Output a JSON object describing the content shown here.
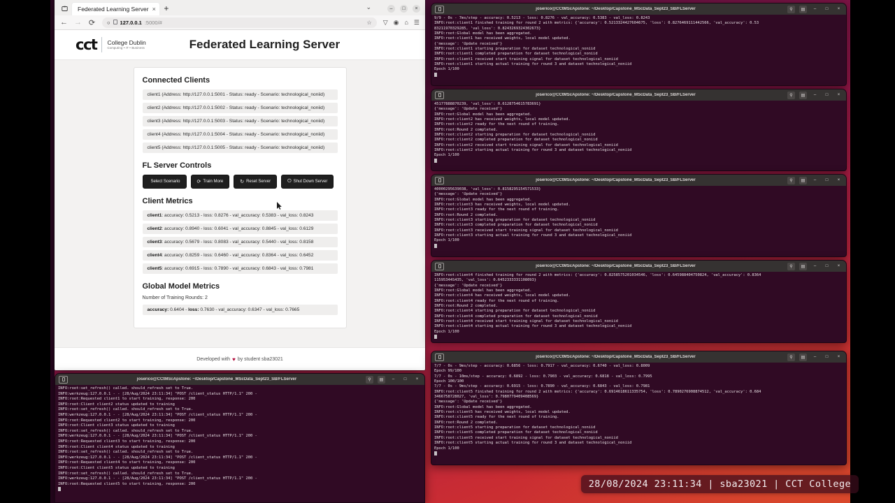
{
  "desktop": {
    "clock": "28/08/2024 23:11:34 | sba23021 | CCT College"
  },
  "browser": {
    "tab": {
      "title": "Federated Learning Server",
      "close": "×"
    },
    "new_tab": "+",
    "tab_list_icon": "tab-list-icon",
    "chevron": "⌄",
    "window_controls": {
      "minimize": "–",
      "maximize": "□",
      "close": "×"
    },
    "nav": {
      "back": "←",
      "forward": "→",
      "reload": "⟳"
    },
    "url": {
      "host": "127.0.0.1",
      "rest": ":5000/#",
      "shield": "○",
      "page_icon": "⬚",
      "star": "☆"
    },
    "nav_icons": {
      "shield": "▽",
      "account": "◉",
      "save": "⌂",
      "menu": "☰"
    }
  },
  "page": {
    "logo": {
      "cct": "cct",
      "line1": "College Dublin",
      "line2": "Computing • IT • Business"
    },
    "title": "Federated Learning Server",
    "connected_clients_heading": "Connected Clients",
    "clients": [
      "client1 (Address: http://127.0.0.1:5001 - Status: ready - Scenario: technological_noniid)",
      "client2 (Address: http://127.0.0.1:5002 - Status: ready - Scenario: technological_noniid)",
      "client3 (Address: http://127.0.0.1:5003 - Status: ready - Scenario: technological_noniid)",
      "client4 (Address: http://127.0.0.1:5004 - Status: ready - Scenario: technological_noniid)",
      "client5 (Address: http://127.0.0.1:5005 - Status: ready - Scenario: technological_noniid)"
    ],
    "controls_heading": "FL Server Controls",
    "buttons": [
      {
        "label": "Select Scenario",
        "icon": ""
      },
      {
        "label": "Train More",
        "icon": "⟳"
      },
      {
        "label": "Reset Server",
        "icon": "↻"
      },
      {
        "label": "Shut Down Server",
        "icon": "⏻"
      }
    ],
    "client_metrics_heading": "Client Metrics",
    "client_metrics": [
      {
        "name": "client1",
        "text": ": accuracy: 0.5213 - loss: 0.8276 - val_accuracy: 0.5383 - val_loss: 0.8243"
      },
      {
        "name": "client2",
        "text": ": accuracy: 0.8940 - loss: 0.6041 - val_accuracy: 0.8845 - val_loss: 0.6129"
      },
      {
        "name": "client3",
        "text": ": accuracy: 0.5679 - loss: 0.8083 - val_accuracy: 0.5440 - val_loss: 0.8158"
      },
      {
        "name": "client4",
        "text": ": accuracy: 0.8259 - loss: 0.6460 - val_accuracy: 0.8364 - val_loss: 0.6452"
      },
      {
        "name": "client5",
        "text": ": accuracy: 0.6915 - loss: 0.7890 - val_accuracy: 0.6843 - val_loss: 0.7981"
      }
    ],
    "global_heading": "Global Model Metrics",
    "rounds_label": "Number of Training Rounds: 2",
    "global_metrics_prefix": "accuracy:",
    "global_metrics_mid": " 0.6404 - ",
    "global_metrics_bold2": "loss:",
    "global_metrics_rest": " 0.7630 - val_accuracy: 0.6347 - val_loss: 0.7665",
    "footer_pre": "Developed with",
    "footer_heart": "♥",
    "footer_post": "by student sba23021"
  },
  "terminals": {
    "title": "joserico@CCtMScApstone: ~/Desktop/Capstone_MScData_Sept23_SB/FLServer",
    "icons": {
      "search": "⚲",
      "menu": "▤",
      "minimize": "–",
      "maximize": "□",
      "close": "×"
    },
    "t1": "9/9 - 0s - 7ms/step - accuracy: 0.5213 - loss: 0.8276 - val_accuracy: 0.5383 - val_loss: 0.8243\nINFO:root:client1 finished training for round 2 with metrics: {'accuracy': 0.5213324427604675, 'loss': 0.8276469111442566, 'val_accuracy': 0.53\n83211970329285, 'val_loss': 0.8243269324302673}\nINFO:root:Global model has been aggregated.\nINFO:root:client1 has received weights, local model updated.\n{'message': 'Update received'}\nINFO:root:client1 starting preparation for dataset technological_noniid\nINFO:root:client1 completed preparation for dataset technological_noniid\nINFO:root:client1 received start training signal for dataset technological_noniid\nINFO:root:client1 starting actual training for round 3 and dataset technological_noniid\nEpoch 1/100",
    "t2": "45177888870239, 'val_loss': 0.6128754615783691}\n{'message': 'Update received'}\nINFO:root:Global model has been aggregated.\nINFO:root:client2 has received weights, local model updated.\nINFO:root:client2 ready for the next round of training.\nINFO:root:Round 2 completed.\nINFO:root:client2 starting preparation for dataset technological_noniid\nINFO:root:client2 completed preparation for dataset technological_noniid\nINFO:root:client2 received start training signal for dataset technological_noniid\nINFO:root:client2 starting actual training for round 3 and dataset technological_noniid\nEpoch 1/100",
    "t3": "40000295639038, 'val_loss': 0.8158295154571533}\n{'message': 'Update received'}\nINFO:root:Global model has been aggregated.\nINFO:root:client3 has received weights, local model updated.\nINFO:root:client3 ready for the next round of training.\nINFO:root:Round 2 completed.\nINFO:root:client3 starting preparation for dataset technological_noniid\nINFO:root:client3 completed preparation for dataset technological_noniid\nINFO:root:client3 received start training signal for dataset technological_noniid\nINFO:root:client3 starting actual training for round 3 and dataset technological_noniid\nEpoch 1/100",
    "t4": "INFO:root:client4 finished training for round 2 with metrics: {'accuracy': 0.8258575201034546, 'loss': 0.645988404750824, 'val_accuracy': 0.8364\n11595344S435, 'val_loss': 0.6452333331108093}\n{'message': 'Update received'}\nINFO:root:Global model has been aggregated.\nINFO:root:client4 has received weights, local model updated.\nINFO:root:client4 ready for the next round of training.\nINFO:root:Round 2 completed.\nINFO:root:client4 starting preparation for dataset technological_noniid\nINFO:root:client4 completed preparation for dataset technological_noniid\nINFO:root:client4 received start training signal for dataset technological_noniid\nINFO:root:client4 starting actual training for round 3 and dataset technological_noniid\nEpoch 1/100",
    "t5": "7/7 - 0s - 9ms/step - accuracy: 0.6856 - loss: 0.7917 - val_accuracy: 0.6740 - val_loss: 0.8009\nEpoch 99/100\n7/7 - 0s - 10ms/step - accuracy: 0.6892 - loss: 0.7903 - val_accuracy: 0.6818 - val_loss: 0.7995\nEpoch 100/100\n7/7 - 0s - 9ms/step - accuracy: 0.6915 - loss: 0.7890 - val_accuracy: 0.6843 - val_loss: 0.7981\nINFO:root:client5 finished training for round 2 with metrics: {'accuracy': 0.6914618611335754, 'loss': 0.7890276908874512, 'val_accuracy': 0.684\n3466758728027, 'val_loss': 0.7980779409408569}\n{'message': 'Update received'}\nINFO:root:Global model has been aggregated.\nINFO:root:client5 has received weights, local model updated.\nINFO:root:client5 ready for the next round of training.\nINFO:root:Round 2 completed.\nINFO:root:client5 starting preparation for dataset technological_noniid\nINFO:root:client5 completed preparation for dataset technological_noniid\nINFO:root:client5 received start training signal for dataset technological_noniid\nINFO:root:client5 starting actual training for round 3 and dataset technological_noniid\nEpoch 1/100",
    "t6": "INFO:root:set_refresh() called. should_refresh set to True.\nINFO:werkzeug:127.0.0.1 - - [28/Aug/2024 23:11:34] \"POST /client_status HTTP/1.1\" 200 -\nINFO:root:Requested client1 to start training, response: 200\nINFO:root:Client client2 status updated to training\nINFO:root:set_refresh() called. should_refresh set to True.\nINFO:werkzeug:127.0.0.1 - - [28/Aug/2024 23:11:34] \"POST /client_status HTTP/1.1\" 200 -\nINFO:root:Requested client2 to start training, response: 200\nINFO:root:Client client3 status updated to training\nINFO:root:set_refresh() called. should_refresh set to True.\nINFO:werkzeug:127.0.0.1 - - [28/Aug/2024 23:11:34] \"POST /client_status HTTP/1.1\" 200 -\nINFO:root:Requested client3 to start training, response: 200\nINFO:root:Client client4 status updated to training\nINFO:root:set_refresh() called. should_refresh set to True.\nINFO:werkzeug:127.0.0.1 - - [28/Aug/2024 23:11:34] \"POST /client_status HTTP/1.1\" 200 -\nINFO:root:Requested client4 to start training, response: 200\nINFO:root:Client client5 status updated to training\nINFO:root:set_refresh() called. should_refresh set to True.\nINFO:werkzeug:127.0.0.1 - - [28/Aug/2024 23:11:34] \"POST /client_status HTTP/1.1\" 200 -\nINFO:root:Requested client5 to start training, response: 200"
  }
}
